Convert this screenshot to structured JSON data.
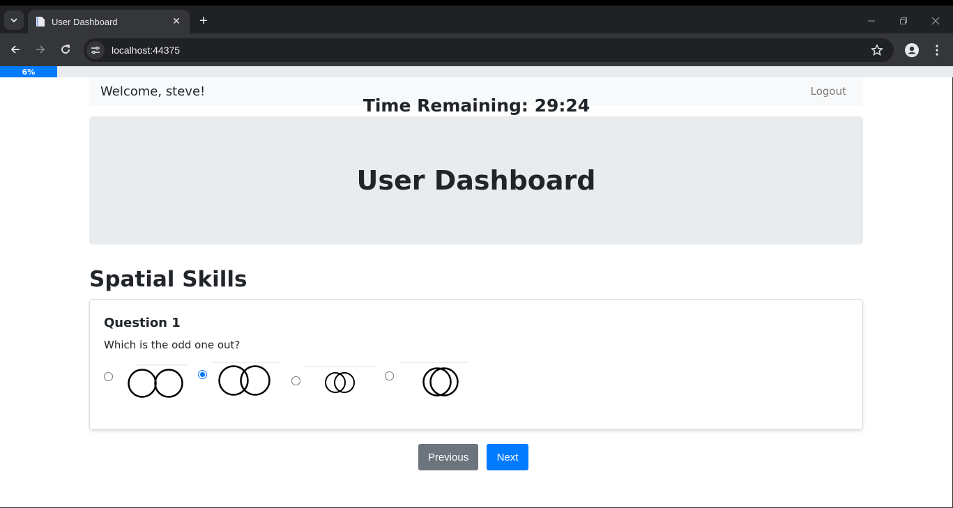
{
  "browser": {
    "tab_title": "User Dashboard",
    "url": "localhost:44375"
  },
  "progress": {
    "label": "6%",
    "value": 6
  },
  "navbar": {
    "welcome": "Welcome, steve!",
    "logout": "Logout"
  },
  "timer": "Time Remaining: 29:24",
  "jumbotron": {
    "title": "User Dashboard"
  },
  "section": {
    "title": "Spatial Skills"
  },
  "question": {
    "title": "Question 1",
    "text": "Which is the odd one out?",
    "options": [
      {
        "image": "two-touching-circles-icon",
        "selected": false
      },
      {
        "image": "two-overlapping-circles-icon",
        "selected": true
      },
      {
        "image": "two-small-overlapping-circles-icon",
        "selected": false
      },
      {
        "image": "two-heavily-overlapping-circles-icon",
        "selected": false
      }
    ]
  },
  "buttons": {
    "previous": "Previous",
    "next": "Next"
  },
  "colors": {
    "primary": "#007bff",
    "secondary": "#6c757d",
    "jumbotron_bg": "#e9ecef",
    "navbar_bg": "#f8f9fa"
  }
}
